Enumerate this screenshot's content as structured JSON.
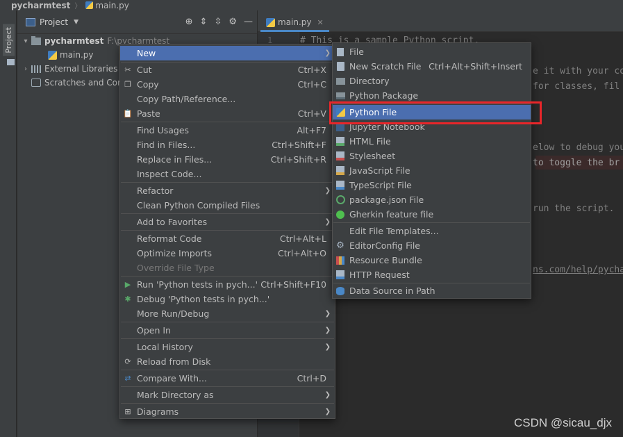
{
  "breadcrumb": {
    "root": "pycharmtest",
    "file": "main.py"
  },
  "tool_strip": {
    "project_label": "Project"
  },
  "project_pane": {
    "title": "Project",
    "tree": [
      {
        "label": "pycharmtest",
        "path": "F:\\pycharmtest"
      },
      {
        "label": "main.py"
      },
      {
        "label": "External Libraries"
      },
      {
        "label": "Scratches and Cor"
      }
    ]
  },
  "editor": {
    "tab_label": "main.py",
    "line_number": "1",
    "lines": [
      "# This is a sample Python script.",
      "e it with your co",
      " for classes, fil",
      "elow to debug you",
      " to toggle the br",
      " run the script.",
      "ns.com/help/pycha"
    ]
  },
  "context_menu": {
    "items": [
      {
        "label": "New",
        "submenu": true,
        "selected": true
      },
      {
        "label": "Cut",
        "shortcut": "Ctrl+X",
        "icon": "cut-icon"
      },
      {
        "label": "Copy",
        "shortcut": "Ctrl+C",
        "icon": "copy-icon"
      },
      {
        "label": "Copy Path/Reference..."
      },
      {
        "label": "Paste",
        "shortcut": "Ctrl+V",
        "icon": "paste-icon"
      },
      {
        "label": "Find Usages",
        "shortcut": "Alt+F7"
      },
      {
        "label": "Find in Files...",
        "shortcut": "Ctrl+Shift+F"
      },
      {
        "label": "Replace in Files...",
        "shortcut": "Ctrl+Shift+R"
      },
      {
        "label": "Inspect Code..."
      },
      {
        "label": "Refactor",
        "submenu": true
      },
      {
        "label": "Clean Python Compiled Files"
      },
      {
        "label": "Add to Favorites",
        "submenu": true
      },
      {
        "label": "Reformat Code",
        "shortcut": "Ctrl+Alt+L"
      },
      {
        "label": "Optimize Imports",
        "shortcut": "Ctrl+Alt+O"
      },
      {
        "label": "Override File Type",
        "disabled": true
      },
      {
        "label": "Run 'Python tests in pych...'",
        "shortcut": "Ctrl+Shift+F10",
        "icon": "run-icon"
      },
      {
        "label": "Debug 'Python tests in pych...'",
        "icon": "debug-icon"
      },
      {
        "label": "More Run/Debug",
        "submenu": true
      },
      {
        "label": "Open In",
        "submenu": true
      },
      {
        "label": "Local History",
        "submenu": true
      },
      {
        "label": "Reload from Disk",
        "icon": "reload-icon"
      },
      {
        "label": "Compare With...",
        "shortcut": "Ctrl+D",
        "icon": "compare-icon"
      },
      {
        "label": "Mark Directory as",
        "submenu": true
      },
      {
        "label": "Diagrams",
        "submenu": true,
        "icon": "diagrams-icon"
      }
    ]
  },
  "new_submenu": {
    "items": [
      {
        "label": "File",
        "icon": "file-icon"
      },
      {
        "label": "New Scratch File",
        "shortcut": "Ctrl+Alt+Shift+Insert",
        "icon": "scratch-file-icon"
      },
      {
        "label": "Directory",
        "icon": "directory-icon"
      },
      {
        "label": "Python Package",
        "icon": "python-package-icon"
      },
      {
        "label": "Python File",
        "icon": "python-file-icon",
        "selected": true
      },
      {
        "label": "Jupyter Notebook",
        "icon": "jupyter-icon"
      },
      {
        "label": "HTML File",
        "icon": "html-icon"
      },
      {
        "label": "Stylesheet",
        "icon": "css-icon"
      },
      {
        "label": "JavaScript File",
        "icon": "javascript-icon"
      },
      {
        "label": "TypeScript File",
        "icon": "typescript-icon"
      },
      {
        "label": "package.json File",
        "icon": "npm-icon"
      },
      {
        "label": "Gherkin feature file",
        "icon": "gherkin-icon"
      },
      {
        "label": "Edit File Templates..."
      },
      {
        "label": "EditorConfig File",
        "icon": "editorconfig-icon"
      },
      {
        "label": "Resource Bundle",
        "icon": "resource-bundle-icon"
      },
      {
        "label": "HTTP Request",
        "icon": "http-request-icon"
      },
      {
        "label": "Data Source in Path",
        "icon": "data-source-icon"
      }
    ]
  },
  "watermark": "CSDN @sicau_djx",
  "colors": {
    "selection": "#4b6eaf",
    "highlight_border": "#e8262a",
    "menu_bg": "#3c3f41"
  }
}
